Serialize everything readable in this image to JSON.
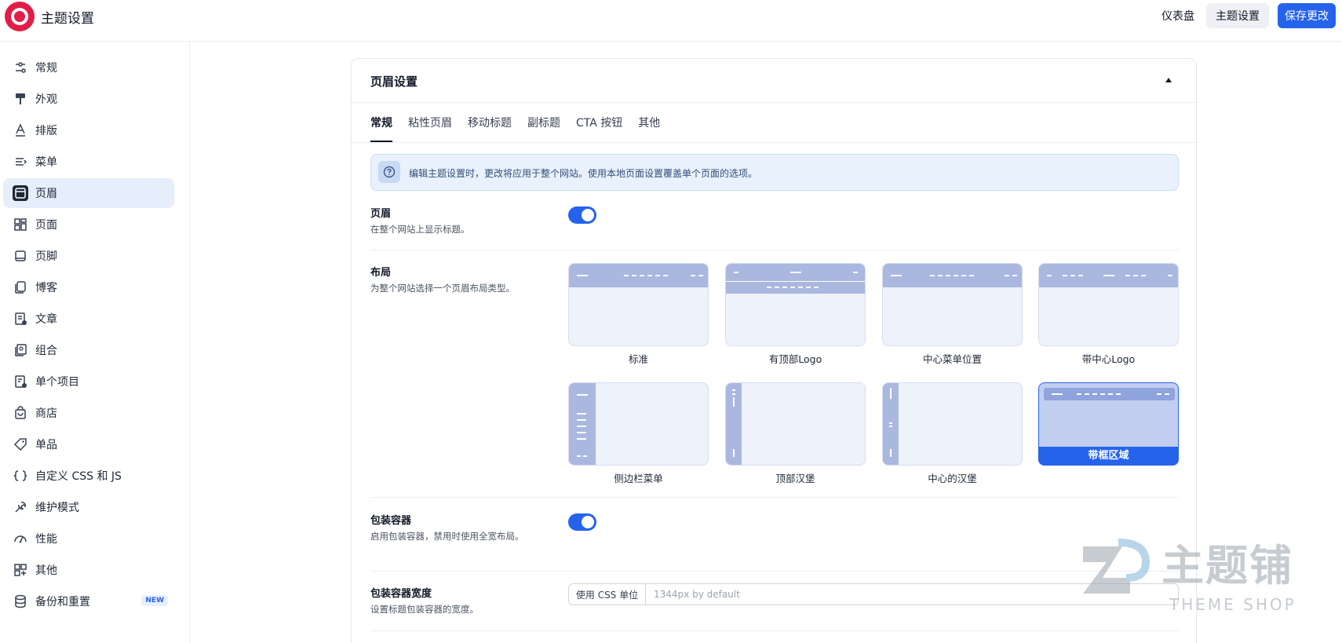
{
  "header": {
    "title": "主题设置",
    "nav_dashboard": "仪表盘",
    "nav_theme_settings": "主题设置",
    "save_label": "保存更改"
  },
  "sidebar": {
    "items": [
      {
        "label": "常规",
        "icon": "sliders-icon"
      },
      {
        "label": "外观",
        "icon": "paint-roller-icon"
      },
      {
        "label": "排版",
        "icon": "typography-icon"
      },
      {
        "label": "菜单",
        "icon": "menu-icon"
      },
      {
        "label": "页眉",
        "icon": "header-icon",
        "active": true
      },
      {
        "label": "页面",
        "icon": "pages-icon"
      },
      {
        "label": "页脚",
        "icon": "footer-icon"
      },
      {
        "label": "博客",
        "icon": "blog-icon"
      },
      {
        "label": "文章",
        "icon": "article-icon"
      },
      {
        "label": "组合",
        "icon": "portfolio-icon"
      },
      {
        "label": "单个项目",
        "icon": "single-item-icon"
      },
      {
        "label": "商店",
        "icon": "shop-bag-icon"
      },
      {
        "label": "单品",
        "icon": "tag-icon"
      },
      {
        "label": "自定义 CSS 和 JS",
        "icon": "code-icon"
      },
      {
        "label": "维护模式",
        "icon": "wrench-icon"
      },
      {
        "label": "性能",
        "icon": "gauge-icon"
      },
      {
        "label": "其他",
        "icon": "grid-icon"
      },
      {
        "label": "备份和重置",
        "icon": "database-icon",
        "badge": "NEW"
      }
    ]
  },
  "card": {
    "title": "页眉设置",
    "tabs": [
      "常规",
      "粘性页眉",
      "移动标题",
      "副标题",
      "CTA 按钮",
      "其他"
    ],
    "active_tab": 0,
    "notice": "编辑主题设置时，更改将应用于整个网站。使用本地页面设置覆盖单个页面的选项。",
    "header_toggle": {
      "label": "页眉",
      "desc": "在整个网站上显示标题。",
      "enabled": true
    },
    "layout": {
      "label": "布局",
      "desc": "为整个网站选择一个页眉布局类型。",
      "options": [
        "标准",
        "有顶部Logo",
        "中心菜单位置",
        "带中心Logo",
        "侧边栏菜单",
        "顶部汉堡",
        "中心的汉堡",
        "带框区域"
      ],
      "selected": 7
    },
    "wrapper_toggle": {
      "label": "包装容器",
      "desc": "启用包装容器，禁用时使用全宽布局。",
      "enabled": true
    },
    "wrapper_width": {
      "label": "包装容器宽度",
      "desc": "设置标题包装容器的宽度。",
      "unit_label": "使用 CSS 单位",
      "placeholder": "1344px by default"
    }
  },
  "watermark": {
    "title": "主题铺",
    "subtitle": "THEME SHOP"
  },
  "colors": {
    "accent": "#2563eb",
    "active_bg": "#e6edfb",
    "notice_bg": "#e8f1fc"
  }
}
